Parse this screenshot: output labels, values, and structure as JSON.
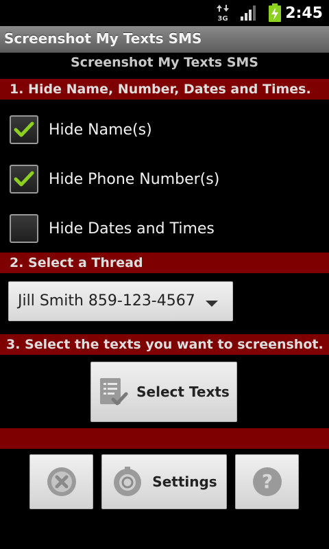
{
  "status_bar": {
    "time": "2:45",
    "network_label": "3G"
  },
  "title_bar": {
    "title": "Screenshot My Texts SMS"
  },
  "main": {
    "heading": "Screenshot My Texts SMS",
    "section1": {
      "label": "1. Hide Name, Number, Dates and Times.",
      "options": [
        {
          "label": "Hide Name(s)",
          "checked": true
        },
        {
          "label": "Hide Phone Number(s)",
          "checked": true
        },
        {
          "label": "Hide Dates and Times",
          "checked": false
        }
      ]
    },
    "section2": {
      "label": "2. Select a Thread",
      "selected_thread": "Jill Smith 859-123-4567"
    },
    "section3": {
      "label": "3. Select the texts you want to screenshot.",
      "select_texts_label": "Select Texts"
    }
  },
  "bottom_bar": {
    "settings_label": "Settings"
  },
  "colors": {
    "section_bar": "#7f0000",
    "check_green": "#8cd11f"
  }
}
